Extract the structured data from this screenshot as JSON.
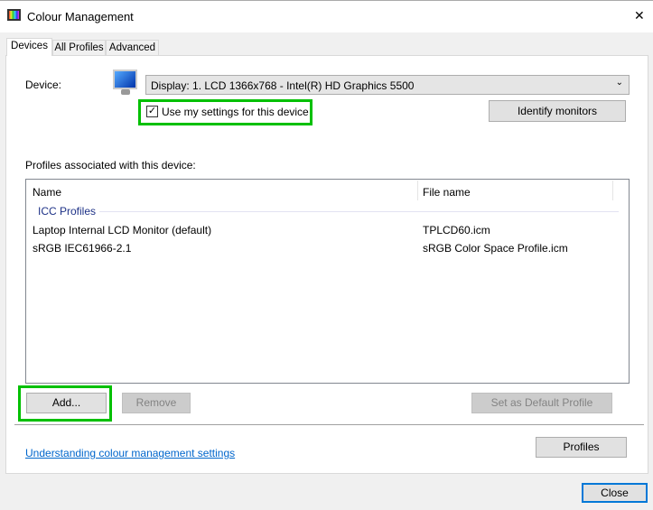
{
  "window": {
    "title": "Colour Management",
    "close_glyph": "✕"
  },
  "tabs": [
    {
      "label": "Devices"
    },
    {
      "label": "All Profiles"
    },
    {
      "label": "Advanced"
    }
  ],
  "device": {
    "label": "Device:",
    "selected": "Display: 1. LCD 1366x768 - Intel(R) HD Graphics 5500",
    "use_my_settings_label": "Use my settings for this device",
    "use_my_settings_checked": true,
    "identify_label": "Identify monitors"
  },
  "profiles": {
    "label": "Profiles associated with this device:",
    "columns": [
      "Name",
      "File name"
    ],
    "group": "ICC Profiles",
    "rows": [
      {
        "name": "Laptop Internal LCD Monitor (default)",
        "file": "TPLCD60.icm"
      },
      {
        "name": "sRGB IEC61966-2.1",
        "file": "sRGB Color Space Profile.icm"
      }
    ]
  },
  "buttons": {
    "add": "Add...",
    "remove": "Remove",
    "set_default": "Set as Default Profile",
    "profiles": "Profiles",
    "close": "Close"
  },
  "link": "Understanding colour management settings",
  "colors": {
    "highlight": "#00c000",
    "link": "#0066cc",
    "accent": "#0078d7"
  }
}
